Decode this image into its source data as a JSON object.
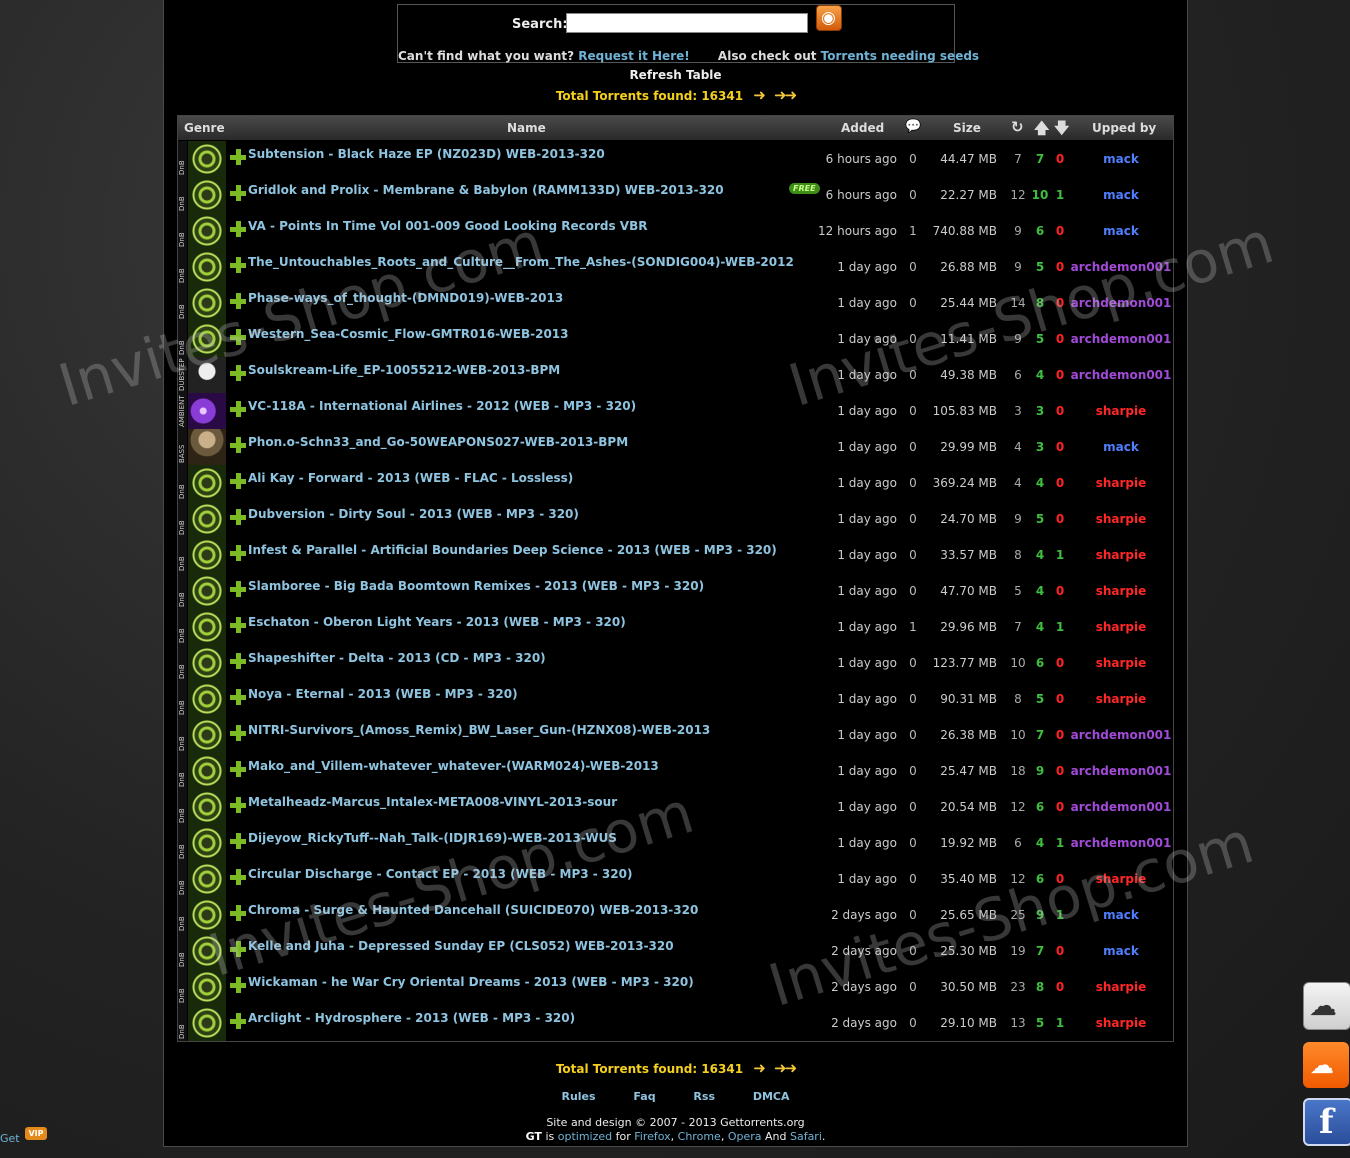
{
  "search": {
    "label": "Search:",
    "placeholder": "",
    "help_text": "Can't find what you want?",
    "request_link": "Request it Here!",
    "also_text": "Also check out",
    "seeds_link": "Torrents needing seeds"
  },
  "refresh_label": "Refresh Table",
  "total_label": "Total Torrents found: 16341",
  "table": {
    "headers": [
      "Genre",
      "Name",
      "Added",
      "Size",
      "Upped by"
    ],
    "rows": [
      {
        "genre": "DnB",
        "name": "Subtension - Black Haze EP (NZ023D) WEB-2013-320",
        "free": false,
        "added": "6 hours ago",
        "comments": "0",
        "size": "44.47 MB",
        "snatched": "7",
        "seeders": "7",
        "leechers": "0",
        "uploader": "mack"
      },
      {
        "genre": "DnB",
        "name": "Gridlok and Prolix - Membrane & Babylon (RAMM133D) WEB-2013-320",
        "free": true,
        "free_label": "FREE",
        "added": "6 hours ago",
        "comments": "0",
        "size": "22.27 MB",
        "snatched": "12",
        "seeders": "10",
        "leechers": "1",
        "uploader": "mack"
      },
      {
        "genre": "DnB",
        "name": "VA - Points In Time Vol 001-009 Good Looking Records VBR",
        "free": false,
        "added": "12 hours ago",
        "comments": "1",
        "size": "740.88 MB",
        "snatched": "9",
        "seeders": "6",
        "leechers": "0",
        "uploader": "mack"
      },
      {
        "genre": "DnB",
        "name": "The_Untouchables_Roots_and_Culture__From_The_Ashes-(SONDIG004)-WEB-2012",
        "free": false,
        "added": "1 day ago",
        "comments": "0",
        "size": "26.88 MB",
        "snatched": "9",
        "seeders": "5",
        "leechers": "0",
        "uploader": "archdemon001"
      },
      {
        "genre": "DnB",
        "name": "Phase-ways_of_thought-(DMND019)-WEB-2013",
        "free": false,
        "added": "1 day ago",
        "comments": "0",
        "size": "25.44 MB",
        "snatched": "14",
        "seeders": "8",
        "leechers": "0",
        "uploader": "archdemon001"
      },
      {
        "genre": "DnB",
        "name": "Western_Sea-Cosmic_Flow-GMTR016-WEB-2013",
        "free": false,
        "added": "1 day ago",
        "comments": "0",
        "size": "11.41 MB",
        "snatched": "9",
        "seeders": "5",
        "leechers": "0",
        "uploader": "archdemon001"
      },
      {
        "genre": "DUBSTEP",
        "name": "Soulskream-Life_EP-10055212-WEB-2013-BPM",
        "free": false,
        "added": "1 day ago",
        "comments": "0",
        "size": "49.38 MB",
        "snatched": "6",
        "seeders": "4",
        "leechers": "0",
        "uploader": "archdemon001"
      },
      {
        "genre": "AMBIENT",
        "name": "VC-118A - International Airlines - 2012 (WEB - MP3 - 320)",
        "free": false,
        "added": "1 day ago",
        "comments": "0",
        "size": "105.83 MB",
        "snatched": "3",
        "seeders": "3",
        "leechers": "0",
        "uploader": "sharpie"
      },
      {
        "genre": "BASS",
        "name": "Phon.o-Schn33_and_Go-50WEAPONS027-WEB-2013-BPM",
        "free": false,
        "added": "1 day ago",
        "comments": "0",
        "size": "29.99 MB",
        "snatched": "4",
        "seeders": "3",
        "leechers": "0",
        "uploader": "mack"
      },
      {
        "genre": "DnB",
        "name": "Ali Kay - Forward - 2013 (WEB - FLAC - Lossless)",
        "free": false,
        "added": "1 day ago",
        "comments": "0",
        "size": "369.24 MB",
        "snatched": "4",
        "seeders": "4",
        "leechers": "0",
        "uploader": "sharpie"
      },
      {
        "genre": "DnB",
        "name": "Dubversion - Dirty Soul - 2013 (WEB - MP3 - 320)",
        "free": false,
        "added": "1 day ago",
        "comments": "0",
        "size": "24.70 MB",
        "snatched": "9",
        "seeders": "5",
        "leechers": "0",
        "uploader": "sharpie"
      },
      {
        "genre": "DnB",
        "name": "Infest & Parallel - Artificial Boundaries Deep Science - 2013 (WEB - MP3 - 320)",
        "free": false,
        "added": "1 day ago",
        "comments": "0",
        "size": "33.57 MB",
        "snatched": "8",
        "seeders": "4",
        "leechers": "1",
        "uploader": "sharpie"
      },
      {
        "genre": "DnB",
        "name": "Slamboree - Big Bada Boomtown Remixes - 2013 (WEB - MP3 - 320)",
        "free": false,
        "added": "1 day ago",
        "comments": "0",
        "size": "47.70 MB",
        "snatched": "5",
        "seeders": "4",
        "leechers": "0",
        "uploader": "sharpie"
      },
      {
        "genre": "DnB",
        "name": "Eschaton - Oberon Light Years - 2013 (WEB - MP3 - 320)",
        "free": false,
        "added": "1 day ago",
        "comments": "1",
        "size": "29.96 MB",
        "snatched": "7",
        "seeders": "4",
        "leechers": "1",
        "uploader": "sharpie"
      },
      {
        "genre": "DnB",
        "name": "Shapeshifter - Delta - 2013 (CD - MP3 - 320)",
        "free": false,
        "added": "1 day ago",
        "comments": "0",
        "size": "123.77 MB",
        "snatched": "10",
        "seeders": "6",
        "leechers": "0",
        "uploader": "sharpie"
      },
      {
        "genre": "DnB",
        "name": "Noya - Eternal - 2013 (WEB - MP3 - 320)",
        "free": false,
        "added": "1 day ago",
        "comments": "0",
        "size": "90.31 MB",
        "snatched": "8",
        "seeders": "5",
        "leechers": "0",
        "uploader": "sharpie"
      },
      {
        "genre": "DnB",
        "name": "NITRI-Survivors_(Amoss_Remix)_BW_Laser_Gun-(HZNX08)-WEB-2013",
        "free": false,
        "added": "1 day ago",
        "comments": "0",
        "size": "26.38 MB",
        "snatched": "10",
        "seeders": "7",
        "leechers": "0",
        "uploader": "archdemon001"
      },
      {
        "genre": "DnB",
        "name": "Mako_and_Villem-whatever_whatever-(WARM024)-WEB-2013",
        "free": false,
        "added": "1 day ago",
        "comments": "0",
        "size": "25.47 MB",
        "snatched": "18",
        "seeders": "9",
        "leechers": "0",
        "uploader": "archdemon001"
      },
      {
        "genre": "DnB",
        "name": "Metalheadz-Marcus_Intalex-META008-VINYL-2013-sour",
        "free": false,
        "added": "1 day ago",
        "comments": "0",
        "size": "20.54 MB",
        "snatched": "12",
        "seeders": "6",
        "leechers": "0",
        "uploader": "archdemon001"
      },
      {
        "genre": "DnB",
        "name": "Dijeyow_RickyTuff--Nah_Talk-(IDJR169)-WEB-2013-WUS",
        "free": false,
        "added": "1 day ago",
        "comments": "0",
        "size": "19.92 MB",
        "snatched": "6",
        "seeders": "4",
        "leechers": "1",
        "uploader": "archdemon001"
      },
      {
        "genre": "DnB",
        "name": "Circular Discharge - Contact EP - 2013 (WEB - MP3 - 320)",
        "free": false,
        "added": "1 day ago",
        "comments": "0",
        "size": "35.40 MB",
        "snatched": "12",
        "seeders": "6",
        "leechers": "0",
        "uploader": "sharpie"
      },
      {
        "genre": "DnB",
        "name": "Chroma - Surge & Haunted Dancehall (SUICIDE070) WEB-2013-320",
        "free": false,
        "added": "2 days ago",
        "comments": "0",
        "size": "25.65 MB",
        "snatched": "25",
        "seeders": "9",
        "leechers": "1",
        "uploader": "mack"
      },
      {
        "genre": "DnB",
        "name": "Kelle and Juha - Depressed Sunday EP (CLS052) WEB-2013-320",
        "free": false,
        "added": "2 days ago",
        "comments": "0",
        "size": "25.30 MB",
        "snatched": "19",
        "seeders": "7",
        "leechers": "0",
        "uploader": "mack"
      },
      {
        "genre": "DnB",
        "name": "Wickaman - he War Cry Oriental Dreams - 2013 (WEB - MP3 - 320)",
        "free": false,
        "added": "2 days ago",
        "comments": "0",
        "size": "30.50 MB",
        "snatched": "23",
        "seeders": "8",
        "leechers": "0",
        "uploader": "sharpie"
      },
      {
        "genre": "DnB",
        "name": "Arclight - Hydrosphere - 2013 (WEB - MP3 - 320)",
        "free": false,
        "added": "2 days ago",
        "comments": "0",
        "size": "29.10 MB",
        "snatched": "13",
        "seeders": "5",
        "leechers": "1",
        "uploader": "sharpie"
      }
    ]
  },
  "footer": {
    "links": [
      "Rules",
      "Faq",
      "Rss",
      "DMCA"
    ],
    "copyright": "Site and design © 2007 - 2013 Gettorrents.org",
    "gt": "GT",
    "is_text": "is",
    "optimized": "optimized",
    "for_text": "for",
    "browser1": "Firefox",
    "browser2": "Chrome",
    "browser3": "Opera",
    "and_text": "And",
    "browser4": "Safari"
  },
  "vip": {
    "get_label": "Get",
    "badge": "VIP"
  },
  "watermark": "Invites-Shop.com",
  "colors": {
    "mack": "#4f7fff",
    "archdemon001": "#a14ad8",
    "sharpie": "#ff2727",
    "accent_total": "#f5d01e"
  }
}
